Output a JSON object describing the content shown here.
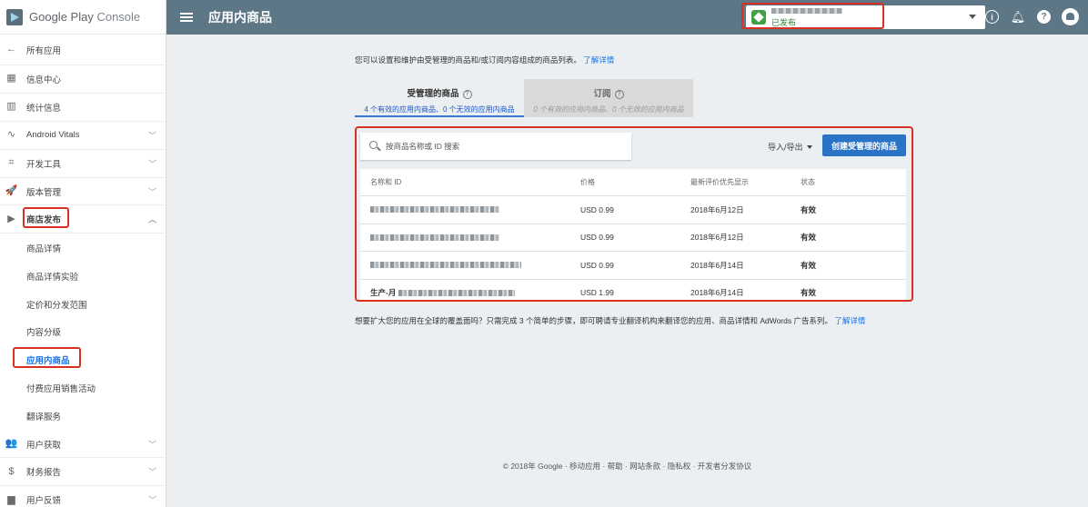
{
  "brand": {
    "google": "Google Play",
    "console": "Console"
  },
  "sidebar": {
    "back_label": "所有应用",
    "items": [
      {
        "label": "信息中心",
        "icon": "dashboard-icon",
        "glyph": "▦"
      },
      {
        "label": "统计信息",
        "icon": "statistics-icon",
        "glyph": "▥"
      },
      {
        "label": "Android Vitals",
        "icon": "vitals-icon",
        "glyph": "∿"
      },
      {
        "label": "开发工具",
        "icon": "dev-tools-icon",
        "glyph": "⌗"
      },
      {
        "label": "版本管理",
        "icon": "release-icon",
        "glyph": "🚀"
      },
      {
        "label": "商店发布",
        "icon": "store-listing-icon",
        "glyph": "▶"
      }
    ],
    "sub_items": [
      {
        "label": "商品详情"
      },
      {
        "label": "商品详情实验"
      },
      {
        "label": "定价和分发范围"
      },
      {
        "label": "内容分级"
      },
      {
        "label": "应用内商品"
      },
      {
        "label": "付费应用销售活动"
      },
      {
        "label": "翻译服务"
      }
    ],
    "bottom_items": [
      {
        "label": "用户获取",
        "icon": "user-acquisition-icon",
        "glyph": "👥"
      },
      {
        "label": "财务报告",
        "icon": "financial-icon",
        "glyph": "$"
      },
      {
        "label": "用户反馈",
        "icon": "feedback-icon",
        "glyph": "▆"
      }
    ]
  },
  "topbar": {
    "title": "应用内商品",
    "app_status": "已发布"
  },
  "main": {
    "intro": "您可以设置和维护由受管理的商品和/或订阅内容组成的商品列表。",
    "intro_link": "了解详情",
    "tabs": [
      {
        "label": "受管理的商品",
        "summary": "4 个有效的应用内商品、0 个无效的应用内商品"
      },
      {
        "label": "订阅",
        "summary": "0 个有效的应用内商品、0 个无效的应用内商品"
      }
    ],
    "search_placeholder": "按商品名称或 ID 搜索",
    "import_export": "导入/导出",
    "create_button": "创建受管理的商品",
    "table": {
      "headers": [
        "名称和 ID",
        "价格",
        "最新评价优先显示",
        "状态"
      ],
      "rows": [
        {
          "prefix": "",
          "price": "USD 0.99",
          "date": "2018年6月12日",
          "status": "有效"
        },
        {
          "prefix": "",
          "price": "USD 0.99",
          "date": "2018年6月12日",
          "status": "有效"
        },
        {
          "prefix": "",
          "price": "USD 0.99",
          "date": "2018年6月14日",
          "status": "有效"
        },
        {
          "prefix": "生产-月",
          "price": "USD 1.99",
          "date": "2018年6月14日",
          "status": "有效"
        }
      ]
    },
    "footer_note": "想要扩大您的应用在全球的覆盖面吗？只需完成 3 个简单的步骤，即可聘请专业翻译机构来翻译您的应用、商品详情和 AdWords 广告系列。",
    "footer_link": "了解详情"
  },
  "copyright": "© 2018年 Google · 移动应用 · 帮助 · 网站条款 · 隐私权 · 开发者分发协议",
  "colors": {
    "topbar": "#5d7786",
    "accent": "#1a73e8",
    "highlight": "#d93025",
    "button": "#2a74c8"
  }
}
